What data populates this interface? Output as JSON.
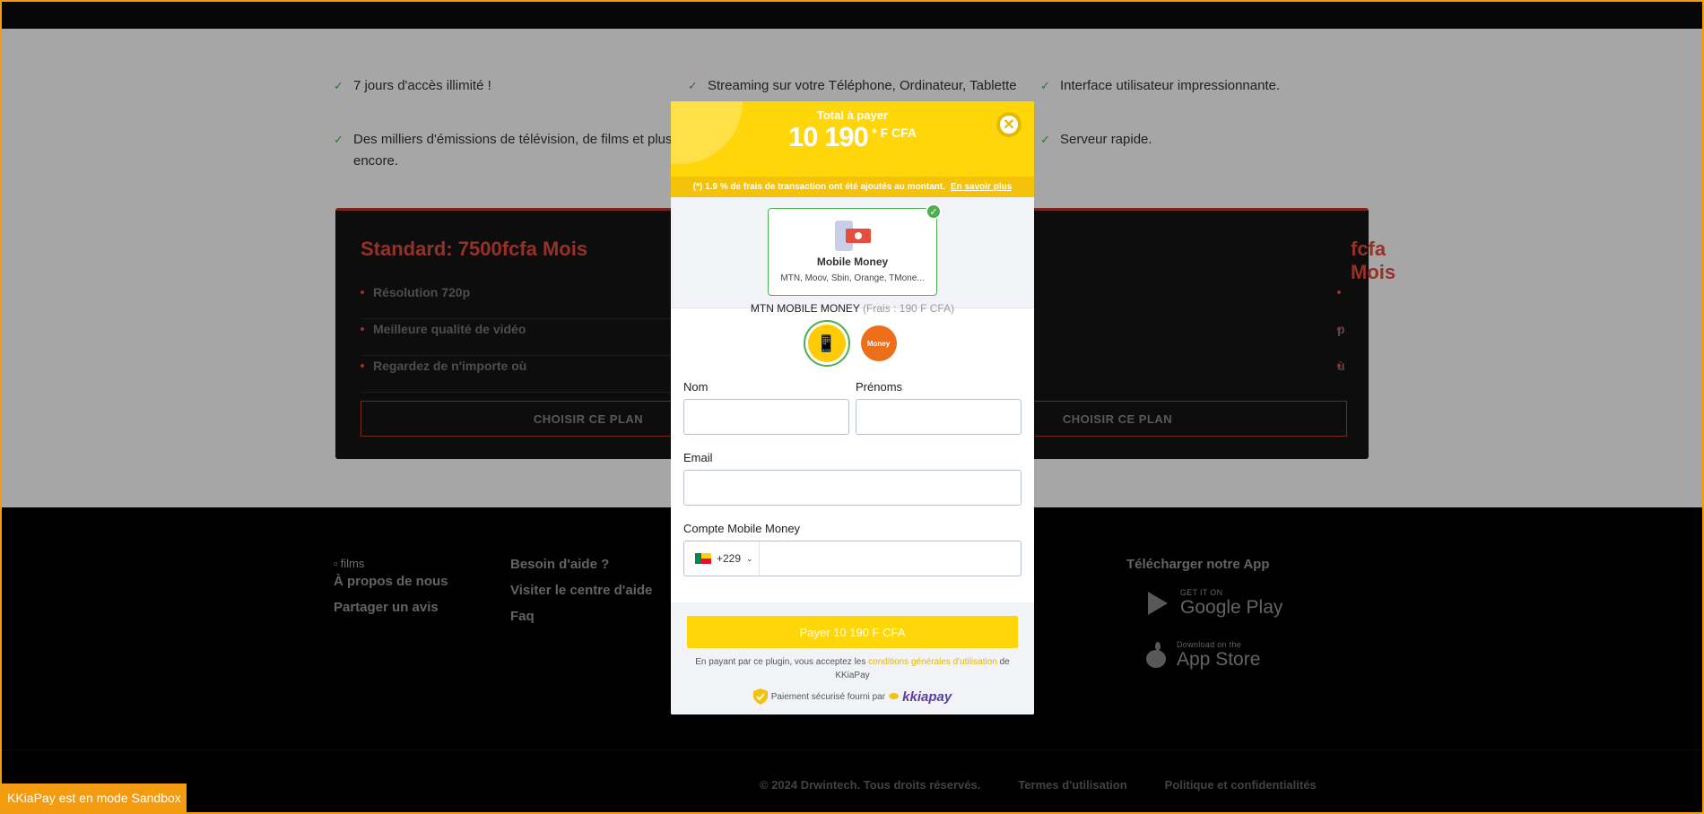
{
  "features": [
    "7 jours d'accès illimité !",
    "Streaming sur votre Téléphone, Ordinateur, Tablette",
    "Interface utilisateur impressionnante.",
    "Des milliers d'émissions de télévision, de films et plus encore.",
    "Serveur rapide."
  ],
  "plans": [
    {
      "title": "Standard: 7500fcfa Mois",
      "items": [
        "Résolution 720p",
        "Meilleure qualité de vidéo",
        "Regardez de n'importe où"
      ],
      "button": "CHOISIR CE PLAN"
    },
    {
      "title": "fcfa Mois",
      "items": [
        "",
        "p",
        "ù"
      ],
      "button": "CHOISIR CE PLAN"
    }
  ],
  "footer": {
    "logo_alt": "films",
    "col1": [
      "À propos de nous",
      "Partager un avis"
    ],
    "col2": [
      "Besoin d'aide ?",
      "Visiter le centre d'aide",
      "Faq"
    ],
    "apps_title": "Télécharger notre App",
    "google_small": "GET IT ON",
    "google_big": "Google Play",
    "apple_small": "Download on the",
    "apple_big": "App Store",
    "copyright": "© 2024 Drwintech. Tous droits réservés.",
    "terms": "Termes d'utilisation",
    "privacy": "Politique et confidentialités"
  },
  "sandbox_badge": "KKiaPay est en mode Sandbox",
  "modal": {
    "total_label": "Total à payer",
    "total_amount": "10 190",
    "total_currency": "* F CFA",
    "fee_note": "(*) 1.9 % de frais de transaction ont été ajoutés au montant.",
    "fee_link": "En savoir plus",
    "method": {
      "name": "Mobile Money",
      "operators": "MTN, Moov, Sbin, Orange, TMone..."
    },
    "operator_name": "MTN MOBILE MONEY",
    "operator_fee": "(Frais : 190 F CFA)",
    "moov_label": "Money",
    "fields": {
      "nom": "Nom",
      "prenoms": "Prénoms",
      "email": "Email",
      "account": "Compte Mobile Money",
      "prefix": "+229"
    },
    "pay_button": "Payer 10 190 F CFA",
    "terms_prefix": "En payant par ce plugin, vous acceptez les",
    "terms_link": "conditions générales d'utilisation",
    "terms_suffix": "de KKiaPay",
    "secure_text": "Paiement sécurisé fourni par",
    "brand": "kkiapay"
  },
  "colors": {
    "accent_yellow": "#ffd60a",
    "plan_red": "#e74c3c",
    "success_green": "#4caf50",
    "sandbox_orange": "#f39c12"
  }
}
